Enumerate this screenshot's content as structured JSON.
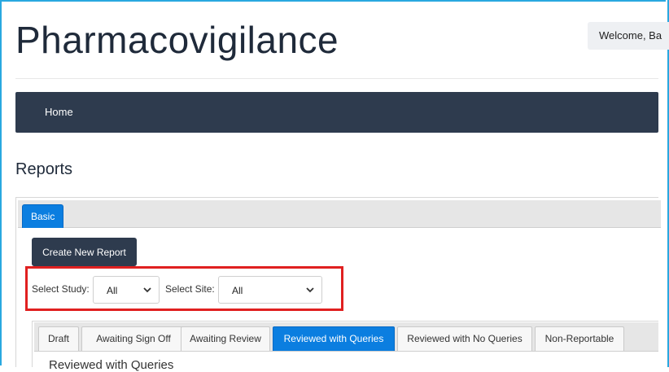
{
  "header": {
    "app_title": "Pharmacovigilance",
    "welcome": "Welcome, Ba"
  },
  "nav": {
    "home": "Home"
  },
  "page": {
    "heading": "Reports"
  },
  "panel_tabs": {
    "basic": "Basic"
  },
  "actions": {
    "create_new_report": "Create New Report"
  },
  "filters": {
    "study_label": "Select Study:",
    "study_value": "All",
    "site_label": "Select Site:",
    "site_value": "All"
  },
  "report_tabs": [
    {
      "label": "Draft"
    },
    {
      "label": "Awaiting Sign Off"
    },
    {
      "label": "Awaiting Review"
    },
    {
      "label": "Reviewed with Queries"
    },
    {
      "label": "Reviewed with No Queries"
    },
    {
      "label": "Non-Reportable"
    }
  ],
  "active_tab": "Reviewed with Queries",
  "section": {
    "heading": "Reviewed with Queries"
  },
  "colors": {
    "navbar": "#2e3b4e",
    "accent": "#0b7ee0",
    "highlight_border": "#e02020",
    "frame_border": "#29a8e0"
  },
  "icons": {
    "select_caret": "chevron-down-icon"
  }
}
